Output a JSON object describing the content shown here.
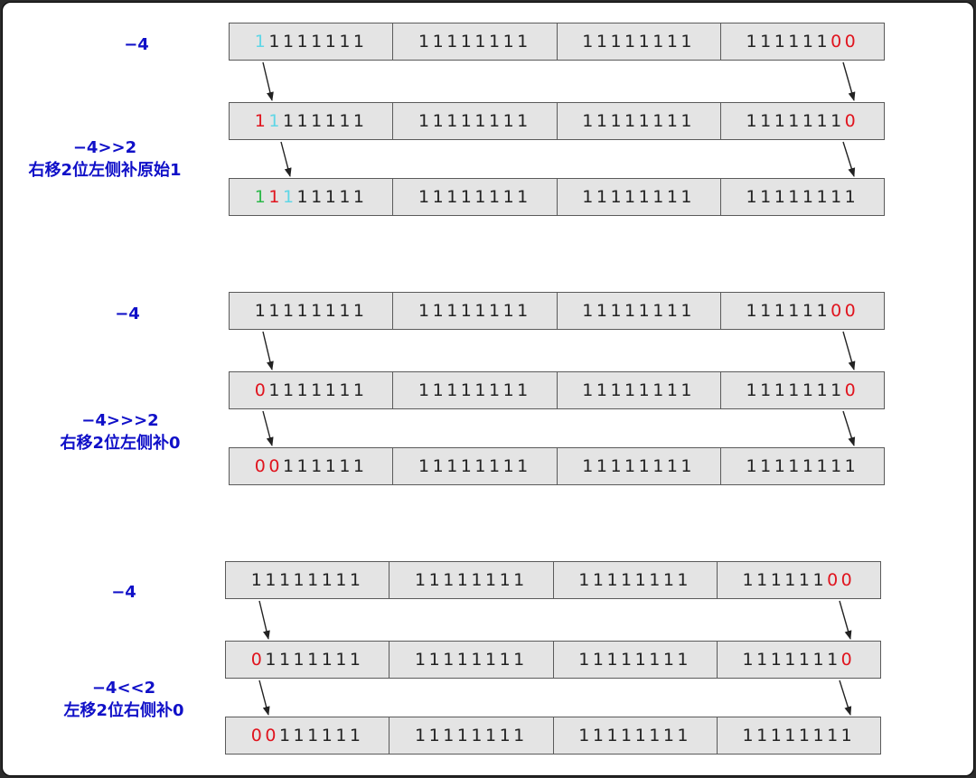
{
  "colors": {
    "red": "#e0141e",
    "cyan": "#5fd6e6",
    "green": "#2db84a",
    "label": "#1010c8",
    "cell_bg": "#e4e4e4"
  },
  "labels": {
    "g1_top": "−4",
    "g1_op": "−4>>2",
    "g1_desc": "右移2位左侧补原始1",
    "g2_top": "−4",
    "g2_op": "−4>>>2",
    "g2_desc": "右移2位左侧补0",
    "g3_top": "−4",
    "g3_op": "−4<<2",
    "g3_desc": "左移2位右侧补0"
  },
  "groups": [
    {
      "rows": [
        {
          "bytes": [
            "11111111",
            "11111111",
            "11111111",
            "11111100"
          ],
          "marks": {
            "0": "c",
            "30": "r",
            "31": "r"
          }
        },
        {
          "bytes": [
            "11111111",
            "11111111",
            "11111111",
            "11111110"
          ],
          "marks": {
            "0": "r",
            "1": "c",
            "31": "r"
          }
        },
        {
          "bytes": [
            "11111111",
            "11111111",
            "11111111",
            "11111111"
          ],
          "marks": {
            "0": "g",
            "1": "r",
            "2": "c"
          }
        }
      ]
    },
    {
      "rows": [
        {
          "bytes": [
            "11111111",
            "11111111",
            "11111111",
            "11111100"
          ],
          "marks": {
            "30": "r",
            "31": "r"
          }
        },
        {
          "bytes": [
            "01111111",
            "11111111",
            "11111111",
            "11111110"
          ],
          "marks": {
            "0": "r",
            "31": "r"
          }
        },
        {
          "bytes": [
            "00111111",
            "11111111",
            "11111111",
            "11111111"
          ],
          "marks": {
            "0": "r",
            "1": "r"
          }
        }
      ]
    },
    {
      "rows": [
        {
          "bytes": [
            "11111111",
            "11111111",
            "11111111",
            "11111100"
          ],
          "marks": {
            "30": "r",
            "31": "r"
          }
        },
        {
          "bytes": [
            "01111111",
            "11111111",
            "11111111",
            "11111110"
          ],
          "marks": {
            "0": "r",
            "31": "r"
          }
        },
        {
          "bytes": [
            "00111111",
            "11111111",
            "11111111",
            "11111111"
          ],
          "marks": {
            "0": "r",
            "1": "r"
          }
        }
      ]
    }
  ]
}
